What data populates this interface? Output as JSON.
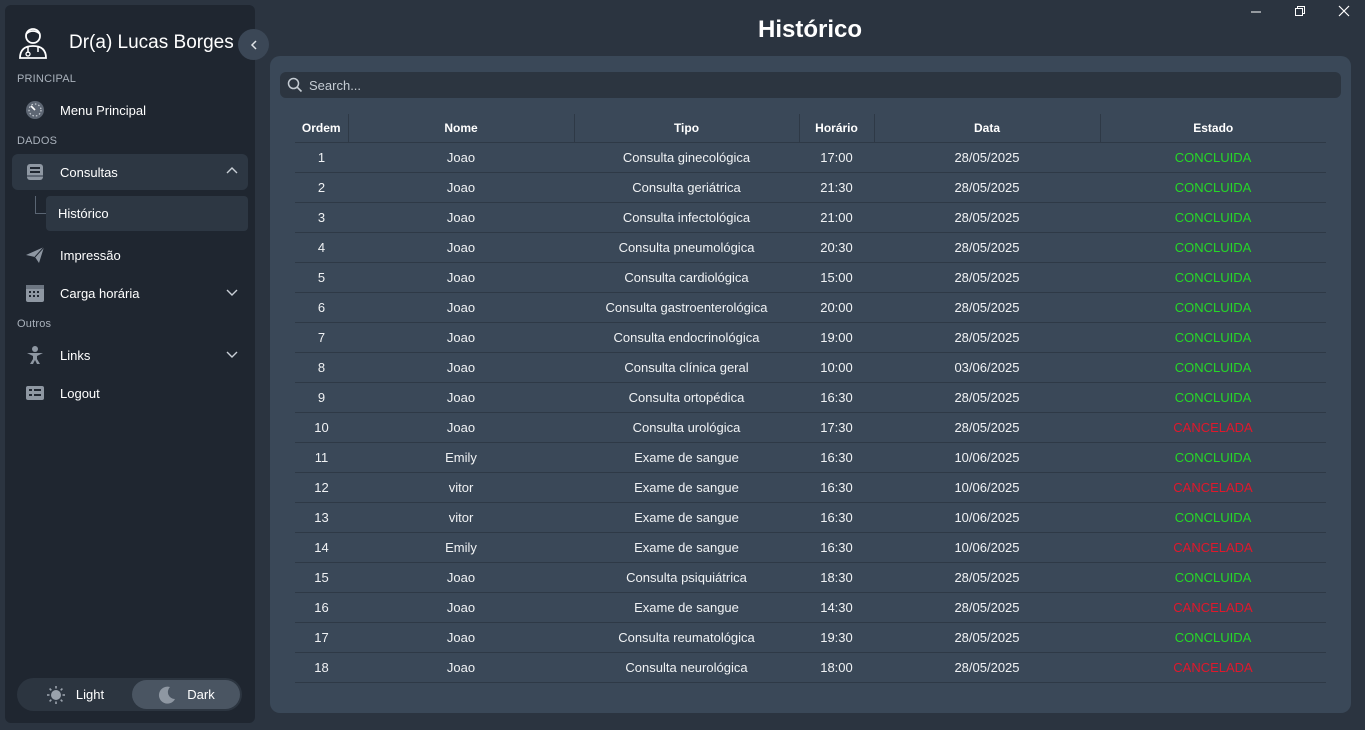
{
  "sidebar": {
    "profile_name": "Dr(a) Lucas Borges",
    "sections": {
      "principal": "PRINCIPAL",
      "dados": "DADOS",
      "outros": "Outros"
    },
    "items": {
      "menu_principal": "Menu Principal",
      "consultas": "Consultas",
      "historico": "Histórico",
      "impressao": "Impressão",
      "carga_horaria": "Carga horária",
      "links": "Links",
      "logout": "Logout"
    },
    "theme": {
      "light": "Light",
      "dark": "Dark",
      "selected": "Dark"
    }
  },
  "page": {
    "title": "Histórico"
  },
  "search": {
    "placeholder": "Search..."
  },
  "table": {
    "columns": [
      "Ordem",
      "Nome",
      "Tipo",
      "Horário",
      "Data",
      "Estado"
    ],
    "rows": [
      [
        "1",
        "Joao",
        "Consulta ginecológica",
        "17:00",
        "28/05/2025",
        "CONCLUIDA"
      ],
      [
        "2",
        "Joao",
        "Consulta geriátrica",
        "21:30",
        "28/05/2025",
        "CONCLUIDA"
      ],
      [
        "3",
        "Joao",
        "Consulta infectológica",
        "21:00",
        "28/05/2025",
        "CONCLUIDA"
      ],
      [
        "4",
        "Joao",
        "Consulta pneumológica",
        "20:30",
        "28/05/2025",
        "CONCLUIDA"
      ],
      [
        "5",
        "Joao",
        "Consulta cardiológica",
        "15:00",
        "28/05/2025",
        "CONCLUIDA"
      ],
      [
        "6",
        "Joao",
        "Consulta gastroenterológica",
        "20:00",
        "28/05/2025",
        "CONCLUIDA"
      ],
      [
        "7",
        "Joao",
        "Consulta endocrinológica",
        "19:00",
        "28/05/2025",
        "CONCLUIDA"
      ],
      [
        "8",
        "Joao",
        "Consulta clínica geral",
        "10:00",
        "03/06/2025",
        "CONCLUIDA"
      ],
      [
        "9",
        "Joao",
        "Consulta ortopédica",
        "16:30",
        "28/05/2025",
        "CONCLUIDA"
      ],
      [
        "10",
        "Joao",
        "Consulta urológica",
        "17:30",
        "28/05/2025",
        "CANCELADA"
      ],
      [
        "11",
        "Emily",
        "Exame de sangue",
        "16:30",
        "10/06/2025",
        "CONCLUIDA"
      ],
      [
        "12",
        "vitor",
        "Exame de sangue",
        "16:30",
        "10/06/2025",
        "CANCELADA"
      ],
      [
        "13",
        "vitor",
        "Exame de sangue",
        "16:30",
        "10/06/2025",
        "CONCLUIDA"
      ],
      [
        "14",
        "Emily",
        "Exame de sangue",
        "16:30",
        "10/06/2025",
        "CANCELADA"
      ],
      [
        "15",
        "Joao",
        "Consulta psiquiátrica",
        "18:30",
        "28/05/2025",
        "CONCLUIDA"
      ],
      [
        "16",
        "Joao",
        "Exame de sangue",
        "14:30",
        "28/05/2025",
        "CANCELADA"
      ],
      [
        "17",
        "Joao",
        "Consulta reumatológica",
        "19:30",
        "28/05/2025",
        "CONCLUIDA"
      ],
      [
        "18",
        "Joao",
        "Consulta neurológica",
        "18:00",
        "28/05/2025",
        "CANCELADA"
      ]
    ]
  },
  "colors": {
    "concluida": "#26d926",
    "cancelada": "#e0182c",
    "accent": "#3a4858"
  }
}
